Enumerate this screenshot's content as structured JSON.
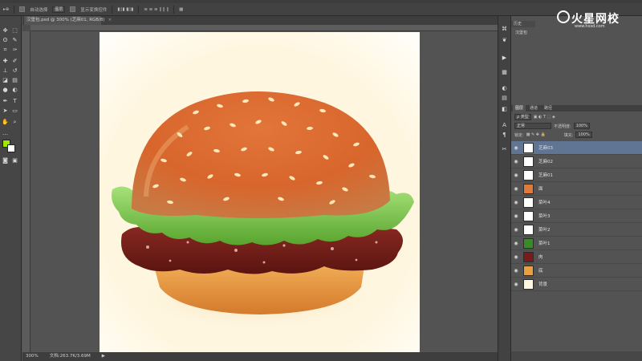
{
  "options_bar": {
    "auto_select_label": "自动选择",
    "auto_select_mode": "图层",
    "show_transform_label": "显示变换控件"
  },
  "document": {
    "tab_title": "汉堡包.psd @ 300% (芝麻01, RGB/8)",
    "close_glyph": "×",
    "zoom": "300%",
    "doc_info": "文档:263.7K/3.69M"
  },
  "watermark": {
    "brand": "火星网校",
    "url": "www.hxsd.com"
  },
  "history_panel": {
    "tab": "历史",
    "item": "汉堡包"
  },
  "layers_panel": {
    "tabs": [
      "图层",
      "通道",
      "路径"
    ],
    "filter_kind": "ρ 类型",
    "blend_mode": "正常",
    "opacity_label": "不透明度:",
    "opacity_value": "100%",
    "lock_label": "锁定:",
    "fill_label": "填充:",
    "fill_value": "100%",
    "layers": [
      {
        "name": "芝麻03",
        "selected": true,
        "thumb": "#ffffff"
      },
      {
        "name": "芝麻02",
        "selected": false,
        "thumb": "#ffffff"
      },
      {
        "name": "芝麻01",
        "selected": false,
        "thumb": "#ffffff"
      },
      {
        "name": "面",
        "selected": false,
        "thumb": "#e07a3a"
      },
      {
        "name": "菜叶4",
        "selected": false,
        "thumb": "#ffffff"
      },
      {
        "name": "菜叶3",
        "selected": false,
        "thumb": "#ffffff"
      },
      {
        "name": "菜叶2",
        "selected": false,
        "thumb": "#ffffff"
      },
      {
        "name": "菜叶1",
        "selected": false,
        "thumb": "#3a8a2a"
      },
      {
        "name": "肉",
        "selected": false,
        "thumb": "#7a1a1a"
      },
      {
        "name": "底",
        "selected": false,
        "thumb": "#e8a040"
      },
      {
        "name": "背景",
        "selected": false,
        "thumb": "#fff6e0"
      }
    ]
  },
  "colors": {
    "foreground": "#a0e800",
    "background": "#ffffff",
    "selected_layer": "#5f7593"
  }
}
